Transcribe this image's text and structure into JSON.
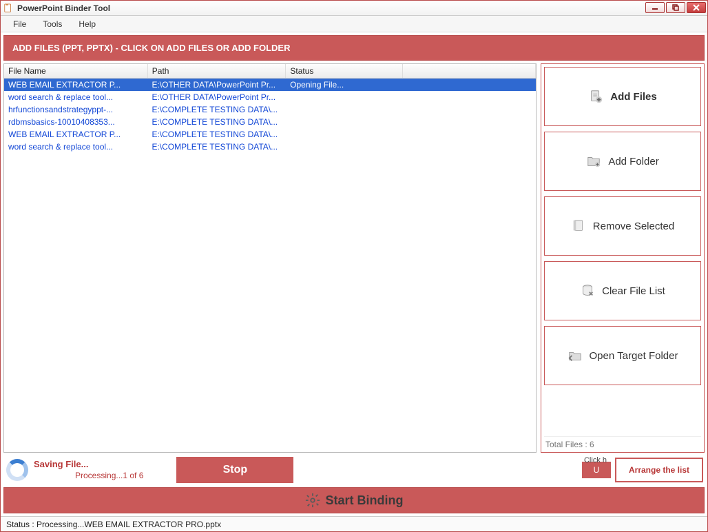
{
  "window": {
    "title": "PowerPoint Binder Tool"
  },
  "menu": {
    "file": "File",
    "tools": "Tools",
    "help": "Help"
  },
  "banner": "ADD FILES (PPT, PPTX) - CLICK ON ADD FILES OR ADD FOLDER",
  "columns": {
    "name": "File Name",
    "path": "Path",
    "status": "Status"
  },
  "rows": [
    {
      "name": "WEB EMAIL EXTRACTOR P...",
      "path": "E:\\OTHER DATA\\PowerPoint Pr...",
      "status": "Opening File...",
      "selected": true
    },
    {
      "name": "word search & replace tool...",
      "path": "E:\\OTHER DATA\\PowerPoint Pr...",
      "status": "",
      "selected": false
    },
    {
      "name": "hrfunctionsandstrategyppt-...",
      "path": "E:\\COMPLETE TESTING DATA\\...",
      "status": "",
      "selected": false
    },
    {
      "name": "rdbmsbasics-10010408353...",
      "path": "E:\\COMPLETE TESTING DATA\\...",
      "status": "",
      "selected": false
    },
    {
      "name": "WEB EMAIL EXTRACTOR P...",
      "path": "E:\\COMPLETE TESTING DATA\\...",
      "status": "",
      "selected": false
    },
    {
      "name": "word search & replace tool...",
      "path": "E:\\COMPLETE TESTING DATA\\...",
      "status": "",
      "selected": false
    }
  ],
  "side": {
    "add_files": "Add Files",
    "add_folder": "Add Folder",
    "remove_selected": "Remove Selected",
    "clear_list": "Clear File List",
    "open_target": "Open Target Folder",
    "total_label": "Total Files : 6"
  },
  "progress": {
    "line1": "Saving File...",
    "line2": "Processing...1 of 6",
    "stop": "Stop",
    "click_hint": "Click h",
    "undo": "U",
    "arrange": "Arrange the list"
  },
  "start": {
    "label": "Start Binding"
  },
  "statusbar": {
    "text": "Status  :  Processing...WEB EMAIL EXTRACTOR PRO.pptx"
  }
}
